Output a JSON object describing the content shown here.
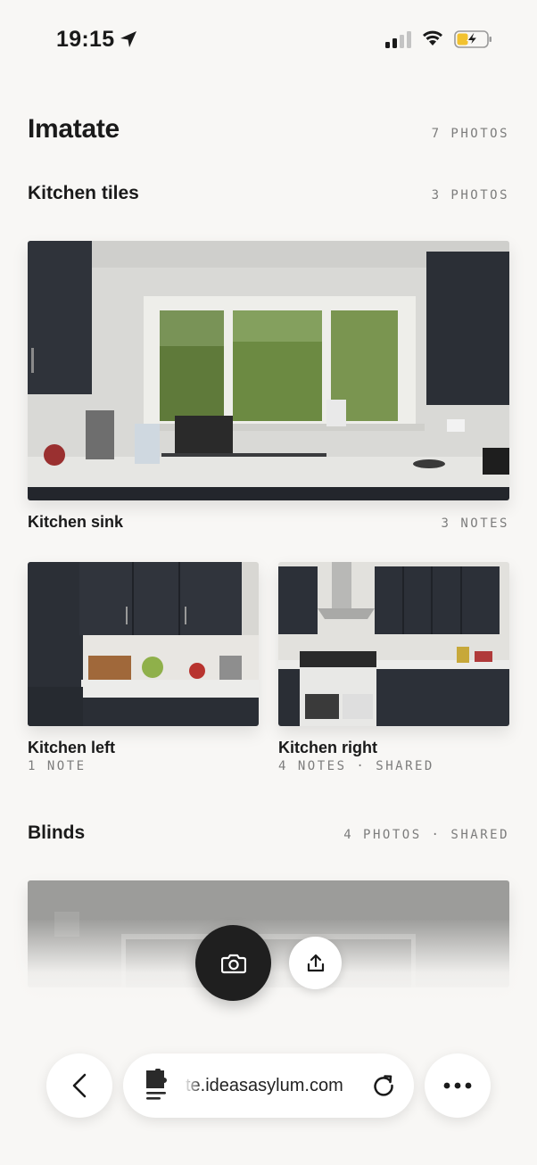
{
  "status_bar": {
    "time": "19:15",
    "icons": [
      "location-arrow-icon",
      "cellular-signal-icon",
      "wifi-icon",
      "battery-charging-icon"
    ]
  },
  "project": {
    "title": "Imatate",
    "photo_count": "7 PHOTOS"
  },
  "albums": [
    {
      "title": "Kitchen tiles",
      "meta": "3 PHOTOS",
      "photos": [
        {
          "title": "Kitchen sink",
          "meta": "3 NOTES"
        },
        {
          "title": "Kitchen left",
          "meta": "1 NOTE"
        },
        {
          "title": "Kitchen right",
          "meta": "4 NOTES · SHARED"
        }
      ]
    },
    {
      "title": "Blinds",
      "meta": "4 PHOTOS · SHARED"
    }
  ],
  "actions": {
    "camera_icon": "camera-icon",
    "share_icon": "share-upload-icon"
  },
  "browser": {
    "url": "te.ideasasylum.com",
    "back_icon": "chevron-left-icon",
    "tab_icon": "page-extension-icon",
    "reload_icon": "reload-icon",
    "more_icon": "more-dots-icon"
  },
  "colors": {
    "background": "#f8f7f5",
    "text": "#1a1a1a",
    "muted": "#7c7c7c",
    "fab_dark": "#1f1f1f",
    "cabinet": "#2c3038"
  }
}
